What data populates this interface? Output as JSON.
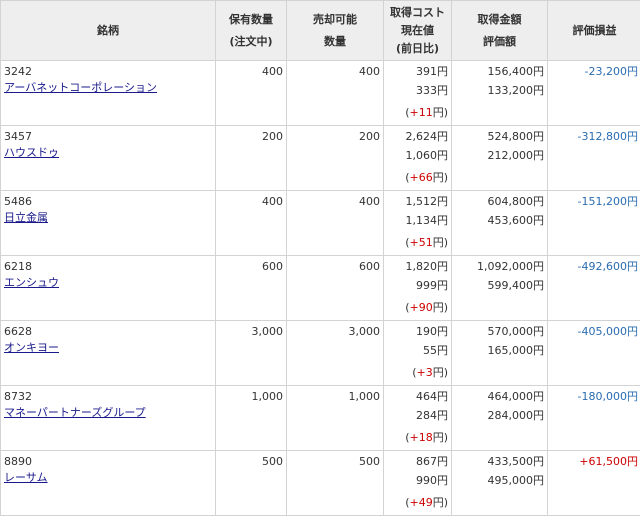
{
  "header": {
    "name": "銘柄",
    "qty_top": "保有数量",
    "qty_bottom": "(注文中)",
    "sellable_top": "売却可能",
    "sellable_bottom": "数量",
    "price_top": "取得コスト",
    "price_mid": "現在値",
    "price_bottom": "(前日比)",
    "amount_top": "取得金額",
    "amount_bottom": "評価額",
    "pl": "評価損益"
  },
  "colors": {
    "gain": "#cc0000",
    "loss": "#2a6cb0",
    "link": "#1a1a8c"
  },
  "rows": [
    {
      "code": "3242",
      "name": "アーバネットコーポレーション",
      "qty": "400",
      "sellable": "400",
      "cost": "391円",
      "price": "333円",
      "change": "+11",
      "change_unit": "円",
      "acq_amount": "156,400円",
      "eval_amount": "133,200円",
      "pl": "-23,200円",
      "pl_sign": "neg"
    },
    {
      "code": "3457",
      "name": "ハウスドゥ",
      "qty": "200",
      "sellable": "200",
      "cost": "2,624円",
      "price": "1,060円",
      "change": "+66",
      "change_unit": "円",
      "acq_amount": "524,800円",
      "eval_amount": "212,000円",
      "pl": "-312,800円",
      "pl_sign": "neg"
    },
    {
      "code": "5486",
      "name": "日立金属",
      "qty": "400",
      "sellable": "400",
      "cost": "1,512円",
      "price": "1,134円",
      "change": "+51",
      "change_unit": "円",
      "acq_amount": "604,800円",
      "eval_amount": "453,600円",
      "pl": "-151,200円",
      "pl_sign": "neg"
    },
    {
      "code": "6218",
      "name": "エンシュウ",
      "qty": "600",
      "sellable": "600",
      "cost": "1,820円",
      "price": "999円",
      "change": "+90",
      "change_unit": "円",
      "acq_amount": "1,092,000円",
      "eval_amount": "599,400円",
      "pl": "-492,600円",
      "pl_sign": "neg"
    },
    {
      "code": "6628",
      "name": "オンキヨー",
      "qty": "3,000",
      "sellable": "3,000",
      "cost": "190円",
      "price": "55円",
      "change": "+3",
      "change_unit": "円",
      "acq_amount": "570,000円",
      "eval_amount": "165,000円",
      "pl": "-405,000円",
      "pl_sign": "neg"
    },
    {
      "code": "8732",
      "name": "マネーパートナーズグループ",
      "qty": "1,000",
      "sellable": "1,000",
      "cost": "464円",
      "price": "284円",
      "change": "+18",
      "change_unit": "円",
      "acq_amount": "464,000円",
      "eval_amount": "284,000円",
      "pl": "-180,000円",
      "pl_sign": "neg"
    },
    {
      "code": "8890",
      "name": "レーサム",
      "qty": "500",
      "sellable": "500",
      "cost": "867円",
      "price": "990円",
      "change": "+49",
      "change_unit": "円",
      "acq_amount": "433,500円",
      "eval_amount": "495,000円",
      "pl": "+61,500円",
      "pl_sign": "pos"
    }
  ]
}
